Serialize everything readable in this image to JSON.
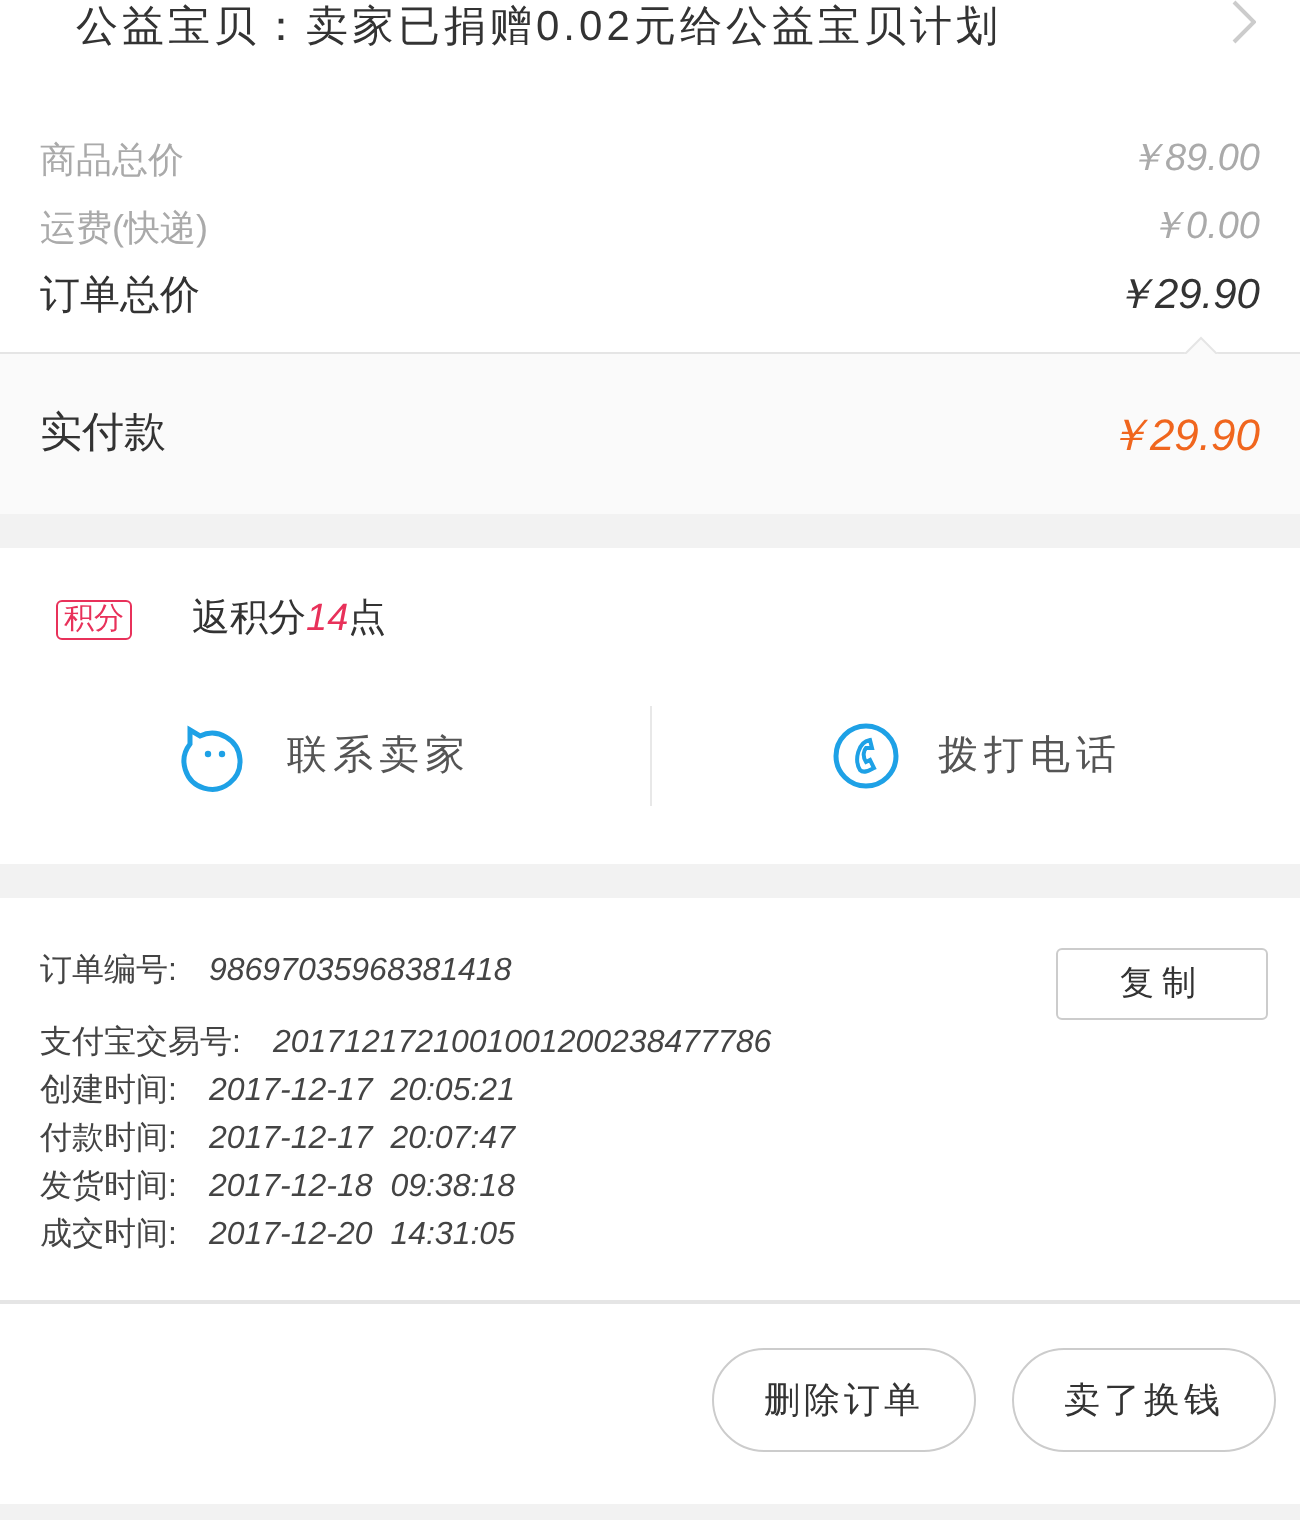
{
  "charity_banner": {
    "text": "公益宝贝：卖家已捐赠0.02元给公益宝贝计划"
  },
  "prices": [
    {
      "kind": "minor",
      "label": "商品总价",
      "value": "￥89.00"
    },
    {
      "kind": "minor",
      "label": "运费(快递)",
      "value": "￥0.00"
    },
    {
      "kind": "major",
      "label": "订单总价",
      "value": "￥29.90"
    }
  ],
  "paid": {
    "label": "实付款",
    "value": "￥29.90"
  },
  "points": {
    "badge": "积分",
    "text": "返积分**14**点"
  },
  "contact_actions": [
    {
      "kind": "chat",
      "label": "联系卖家"
    },
    {
      "kind": "phone",
      "label": "拨打电话"
    }
  ],
  "order_info": [
    {
      "label": "订单编号:",
      "value": "98697035968381418"
    },
    {
      "label": "支付宝交易号:",
      "value": "2017121721001001200238477786"
    },
    {
      "label": "创建时间:",
      "value": "2017-12-17  20:05:21"
    },
    {
      "label": "付款时间:",
      "value": "2017-12-17  20:07:47"
    },
    {
      "label": "发货时间:",
      "value": "2017-12-18  09:38:18"
    },
    {
      "label": "成交时间:",
      "value": "2017-12-20  14:31:05"
    }
  ],
  "copy_button": "复制",
  "bottom_buttons": [
    "删除订单",
    "卖了换钱"
  ]
}
